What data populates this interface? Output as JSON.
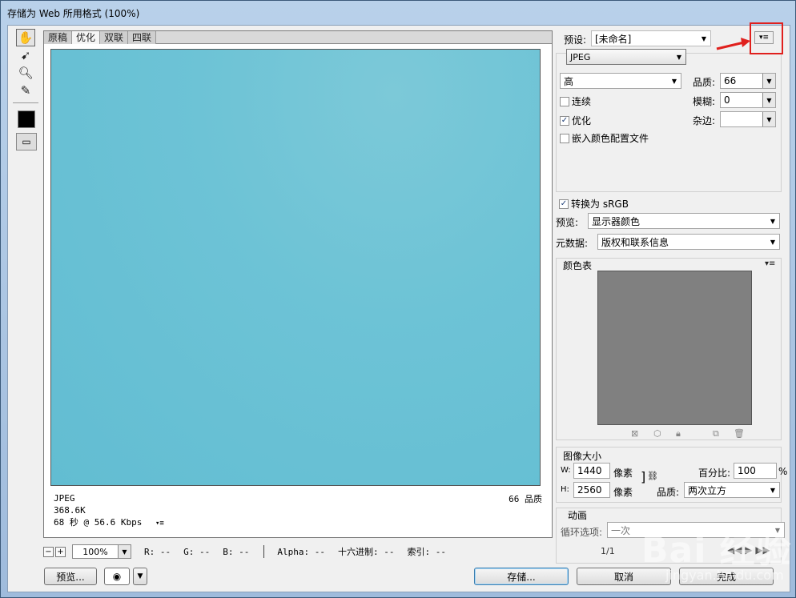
{
  "window": {
    "title": "存储为 Web 所用格式 (100%)"
  },
  "tools": [
    "hand-icon",
    "slice-select-icon",
    "zoom-icon",
    "eyedropper-icon"
  ],
  "tabs": [
    "原稿",
    "优化",
    "双联",
    "四联"
  ],
  "preview": {
    "info_format": "JPEG",
    "info_size": "368.6K",
    "info_time": "68 秒 @ 56.6 Kbps",
    "info_quality": "66 品质"
  },
  "bottom": {
    "zoom": "100%",
    "r": "R: --",
    "g": "G: --",
    "b": "B: --",
    "alpha": "Alpha: --",
    "hex": "十六进制: --",
    "index": "索引: --"
  },
  "buttons": {
    "preview": "预览...",
    "save": "存储...",
    "cancel": "取消",
    "done": "完成"
  },
  "settings": {
    "preset_label": "预设:",
    "preset_value": "[未命名]",
    "format": "JPEG",
    "compression": "高",
    "quality_label": "品质:",
    "quality_value": "66",
    "progressive": "连续",
    "blur_label": "模糊:",
    "blur_value": "0",
    "optimized": "优化",
    "matte_label": "杂边:",
    "embed_profile": "嵌入颜色配置文件",
    "convert_srgb": "转换为 sRGB",
    "preview_label": "预览:",
    "preview_value": "显示器颜色",
    "metadata_label": "元数据:",
    "metadata_value": "版权和联系信息"
  },
  "color_table": {
    "title": "颜色表"
  },
  "image_size": {
    "title": "图像大小",
    "w_label": "W:",
    "w_value": "1440",
    "w_unit": "像素",
    "h_label": "H:",
    "h_value": "2560",
    "h_unit": "像素",
    "percent_label": "百分比:",
    "percent_value": "100",
    "percent_unit": "%",
    "quality_label": "品质:",
    "quality_value": "两次立方"
  },
  "animation": {
    "title": "动画",
    "loop_label": "循环选项:",
    "loop_value": "一次",
    "frame": "1/1"
  },
  "watermark": {
    "brand": "Bai 经验",
    "url": "jingyan.baidu.com"
  },
  "colors": {
    "image": "#6bc2d6",
    "highlight": "#e0201d",
    "arrow": "#e0201d"
  }
}
